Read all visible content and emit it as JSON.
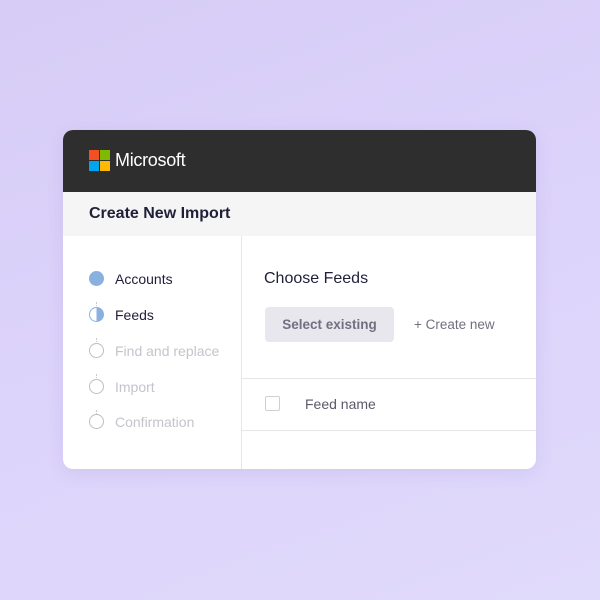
{
  "brand": {
    "name": "Microsoft",
    "logo_colors": [
      "#f25022",
      "#7fba00",
      "#00a4ef",
      "#ffb900"
    ]
  },
  "page": {
    "title": "Create New Import"
  },
  "steps": [
    {
      "label": "Accounts",
      "state": "completed"
    },
    {
      "label": "Feeds",
      "state": "current"
    },
    {
      "label": "Find and replace",
      "state": "upcoming"
    },
    {
      "label": "Import",
      "state": "upcoming"
    },
    {
      "label": "Confirmation",
      "state": "upcoming"
    }
  ],
  "main": {
    "heading": "Choose Feeds",
    "select_existing_label": "Select existing",
    "create_new_label": "+ Create new",
    "table": {
      "columns": [
        "Feed name"
      ]
    }
  },
  "colors": {
    "topbar": "#2e2e2e",
    "step_accent": "#8ab0e0",
    "background": "#d6ccf5"
  }
}
